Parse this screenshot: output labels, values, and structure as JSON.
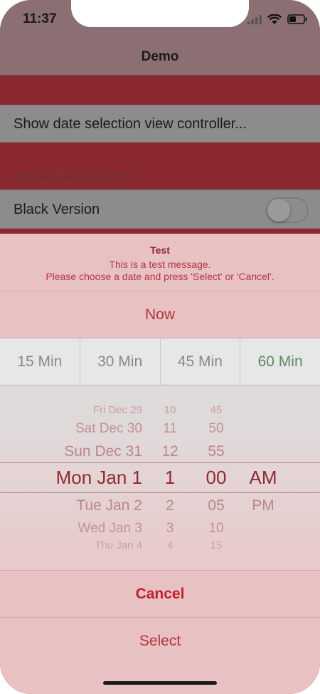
{
  "status_bar": {
    "time": "11:37"
  },
  "nav": {
    "title": "Demo"
  },
  "rows": {
    "show_date": "Show date selection view controller...",
    "section_header": "COLORS AND EFFECTS",
    "black_version": "Black Version",
    "black_version_on": false
  },
  "sheet": {
    "title": "Test",
    "message_line1": "This is a test message.",
    "message_line2": "Please choose a date and press 'Select' or 'Cancel'.",
    "now_label": "Now",
    "segments": [
      "15 Min",
      "30 Min",
      "45 Min",
      "60 Min"
    ],
    "picker": {
      "dates": [
        "Fri Dec 29",
        "Sat Dec 30",
        "Sun Dec 31",
        "Mon Jan 1",
        "Tue Jan 2",
        "Wed Jan 3",
        "Thu Jan 4"
      ],
      "hours": [
        "10",
        "11",
        "12",
        "1",
        "2",
        "3",
        "4"
      ],
      "minutes": [
        "45",
        "50",
        "55",
        "00",
        "05",
        "10",
        "15"
      ],
      "ampm": [
        "AM",
        "PM"
      ]
    },
    "cancel_label": "Cancel",
    "select_label": "Select"
  },
  "colors": {
    "accent": "#b2373e",
    "cancel": "#c0222b",
    "sheet_background": "#e8c1c3"
  }
}
